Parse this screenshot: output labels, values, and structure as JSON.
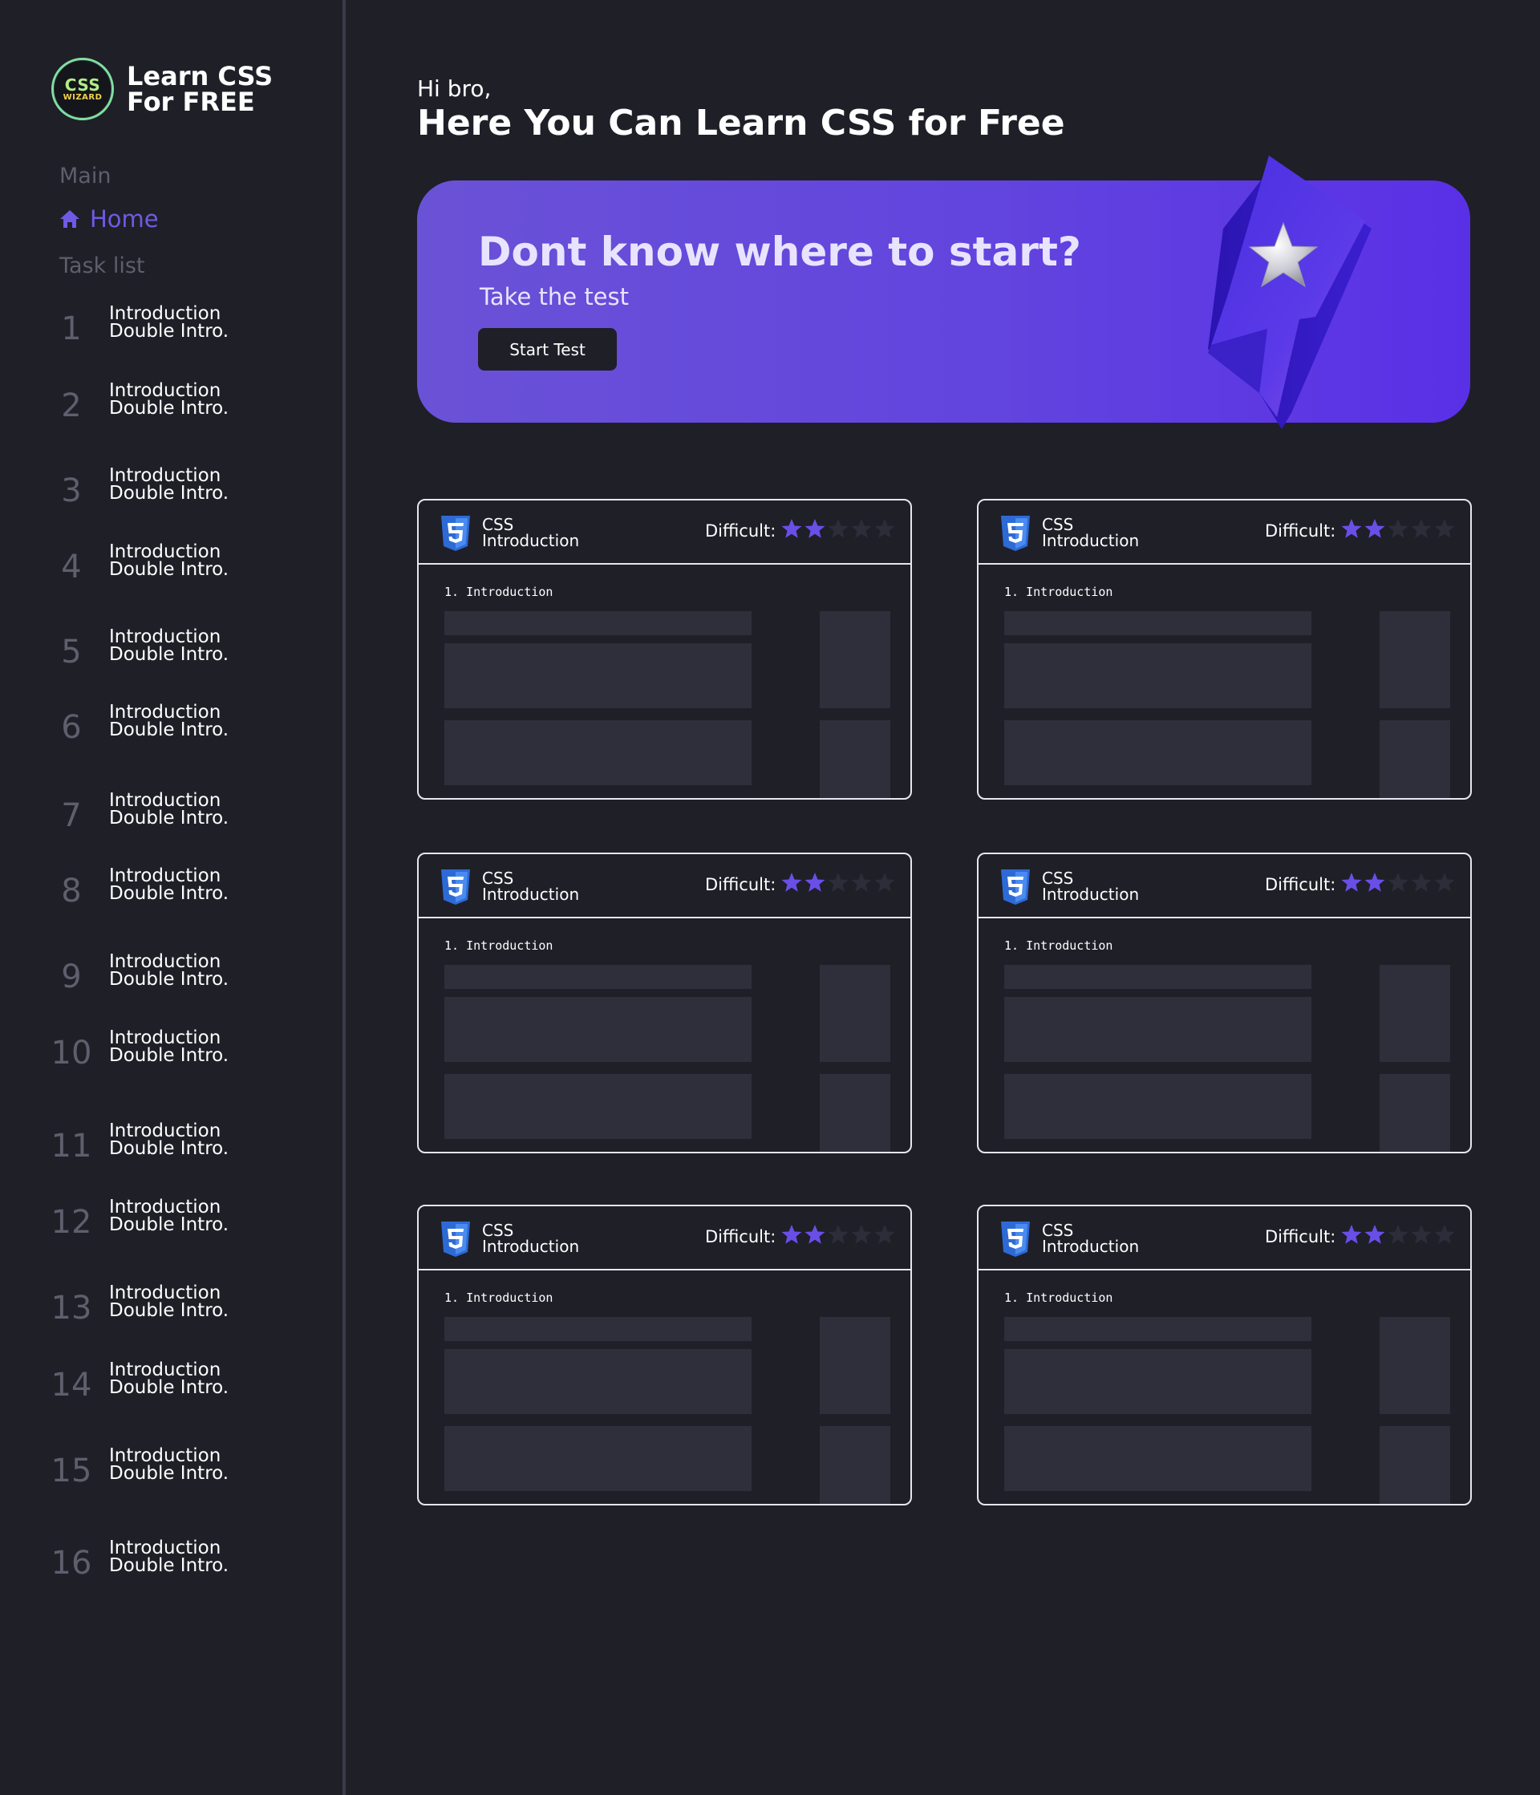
{
  "brand": {
    "logo_line1": "CSS",
    "logo_line2": "WIZARD",
    "title_line1": "Learn CSS",
    "title_line2": "For FREE"
  },
  "sidebar": {
    "main_label": "Main",
    "home_label": "Home",
    "tasklist_label": "Task list",
    "tasks": [
      {
        "num": "1",
        "title": "Introduction",
        "sub": "Double Intro."
      },
      {
        "num": "2",
        "title": "Introduction",
        "sub": "Double Intro."
      },
      {
        "num": "3",
        "title": "Introduction",
        "sub": "Double Intro."
      },
      {
        "num": "4",
        "title": "Introduction",
        "sub": "Double Intro."
      },
      {
        "num": "5",
        "title": "Introduction",
        "sub": "Double Intro."
      },
      {
        "num": "6",
        "title": "Introduction",
        "sub": "Double Intro."
      },
      {
        "num": "7",
        "title": "Introduction",
        "sub": "Double Intro."
      },
      {
        "num": "8",
        "title": "Introduction",
        "sub": "Double Intro."
      },
      {
        "num": "9",
        "title": "Introduction",
        "sub": "Double Intro."
      },
      {
        "num": "10",
        "title": "Introduction",
        "sub": "Double Intro."
      },
      {
        "num": "11",
        "title": "Introduction",
        "sub": "Double Intro."
      },
      {
        "num": "12",
        "title": "Introduction",
        "sub": "Double Intro."
      },
      {
        "num": "13",
        "title": "Introduction",
        "sub": "Double Intro."
      },
      {
        "num": "14",
        "title": "Introduction",
        "sub": "Double Intro."
      },
      {
        "num": "15",
        "title": "Introduction",
        "sub": "Double Intro."
      },
      {
        "num": "16",
        "title": "Introduction",
        "sub": "Double Intro."
      }
    ]
  },
  "header": {
    "greeting": "Hi bro,",
    "headline": "Here You Can Learn CSS for Free"
  },
  "banner": {
    "title": "Dont know where to start?",
    "subtitle": "Take the test",
    "button_label": "Start Test",
    "illustration": "lightning-bolt-star-icon"
  },
  "cards": [
    {
      "lang": "CSS",
      "topic": "Introduction",
      "difficulty_label": "Difficult:",
      "rating": 2,
      "max_rating": 5,
      "body_title": "1. Introduction"
    },
    {
      "lang": "CSS",
      "topic": "Introduction",
      "difficulty_label": "Difficult:",
      "rating": 2,
      "max_rating": 5,
      "body_title": "1. Introduction"
    },
    {
      "lang": "CSS",
      "topic": "Introduction",
      "difficulty_label": "Difficult:",
      "rating": 2,
      "max_rating": 5,
      "body_title": "1. Introduction"
    },
    {
      "lang": "CSS",
      "topic": "Introduction",
      "difficulty_label": "Difficult:",
      "rating": 2,
      "max_rating": 5,
      "body_title": "1. Introduction"
    },
    {
      "lang": "CSS",
      "topic": "Introduction",
      "difficulty_label": "Difficult:",
      "rating": 2,
      "max_rating": 5,
      "body_title": "1. Introduction"
    },
    {
      "lang": "CSS",
      "topic": "Introduction",
      "difficulty_label": "Difficult:",
      "rating": 2,
      "max_rating": 5,
      "body_title": "1. Introduction"
    }
  ],
  "colors": {
    "background": "#1f1f28",
    "accent": "#6f5ae6",
    "star_active": "#6a4ee8",
    "star_inactive": "#2c2d38",
    "placeholder": "#2e2f3a"
  }
}
